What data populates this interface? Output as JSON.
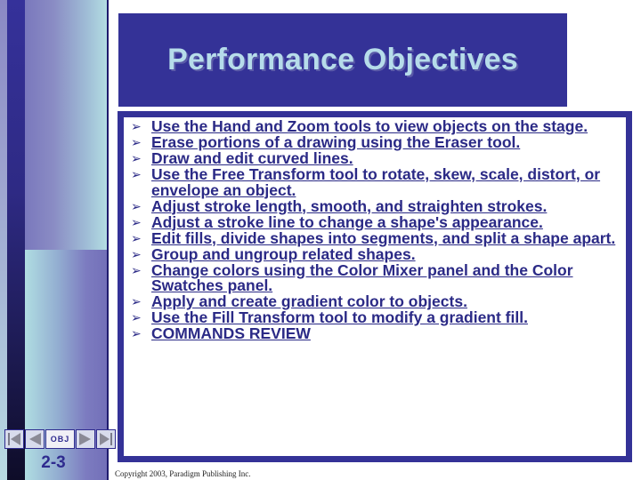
{
  "slide": {
    "title": "Performance Objectives",
    "slide_number": "2-3",
    "copyright": "Copyright 2003, Paradigm Publishing Inc."
  },
  "nav": {
    "buttons": [
      {
        "icon": "first-slide-icon",
        "label": ""
      },
      {
        "icon": "previous-slide-icon",
        "label": ""
      },
      {
        "icon": "",
        "label": "OBJ"
      },
      {
        "icon": "next-slide-icon",
        "label": ""
      },
      {
        "icon": "last-slide-icon",
        "label": ""
      }
    ]
  },
  "objectives": [
    "Use the Hand and Zoom tools to view objects on the stage.",
    "Erase portions of a drawing using the Eraser tool.",
    "Draw and edit curved lines.",
    "Use the Free Transform tool to rotate, skew, scale, distort, or envelope an object.",
    "Adjust stroke length, smooth, and straighten strokes.",
    "Adjust a stroke line to change a shape's appearance.",
    "Edit fills, divide shapes into segments, and split a shape apart.",
    "Group and ungroup related shapes.",
    "Change colors using the Color Mixer panel and the Color Swatches panel.",
    "Apply and create gradient color to objects.",
    "Use the Fill Transform tool to modify a gradient fill.",
    "COMMANDS REVIEW"
  ],
  "bullet_glyph": "➢",
  "colors": {
    "brand_blue": "#343297",
    "title_text": "#b6dcea",
    "body_text": "#2b2a86"
  }
}
